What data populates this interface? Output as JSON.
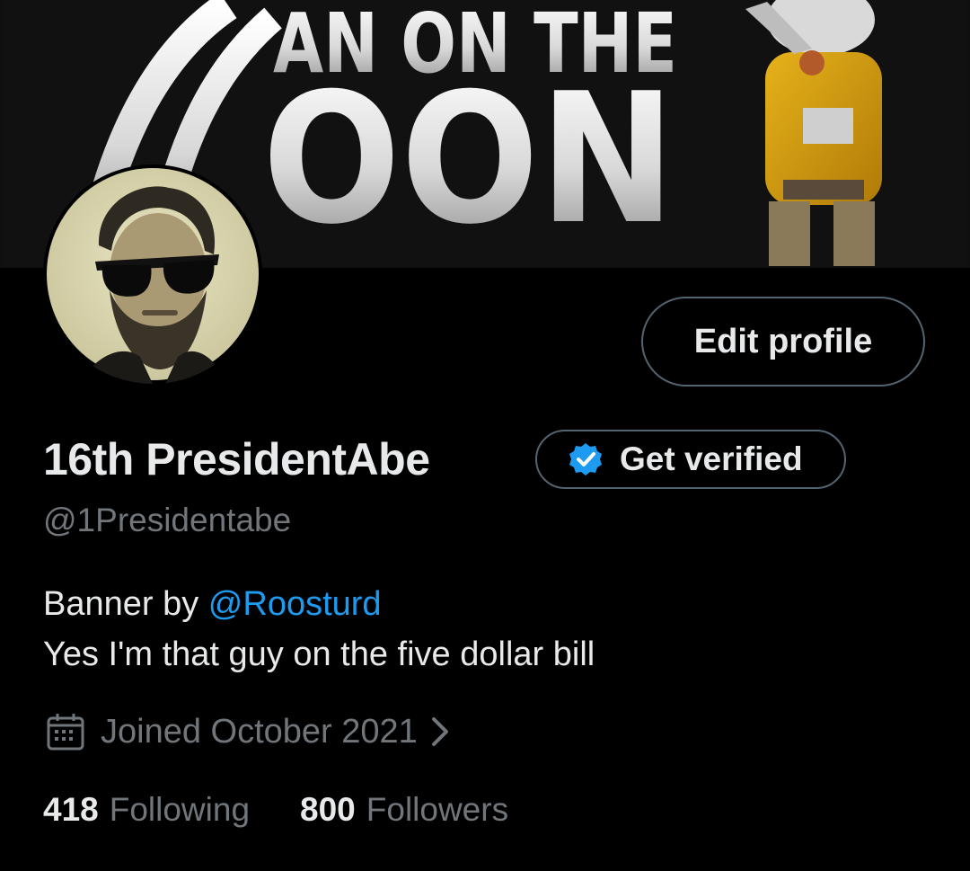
{
  "banner": {
    "line1": "MAN ON THE",
    "line2": "MOON"
  },
  "profile": {
    "display_name": "16th PresidentAbe",
    "handle": "@1Presidentabe",
    "edit_button_label": "Edit profile",
    "get_verified_label": "Get verified",
    "bio": {
      "line1_prefix": "Banner by ",
      "line1_mention": "@Roosturd",
      "line2": "Yes I'm that guy on the five dollar bill"
    },
    "joined": "Joined October 2021",
    "stats": {
      "following_count": "418",
      "following_label": "Following",
      "followers_count": "800",
      "followers_label": "Followers"
    }
  },
  "colors": {
    "background": "#000000",
    "text_primary": "#e7e9ea",
    "text_secondary": "#71767b",
    "accent": "#1d9bf0",
    "border": "#536471"
  },
  "icons": {
    "verified": "verified-badge-icon",
    "calendar": "calendar-icon",
    "chevron": "chevron-right-icon"
  }
}
